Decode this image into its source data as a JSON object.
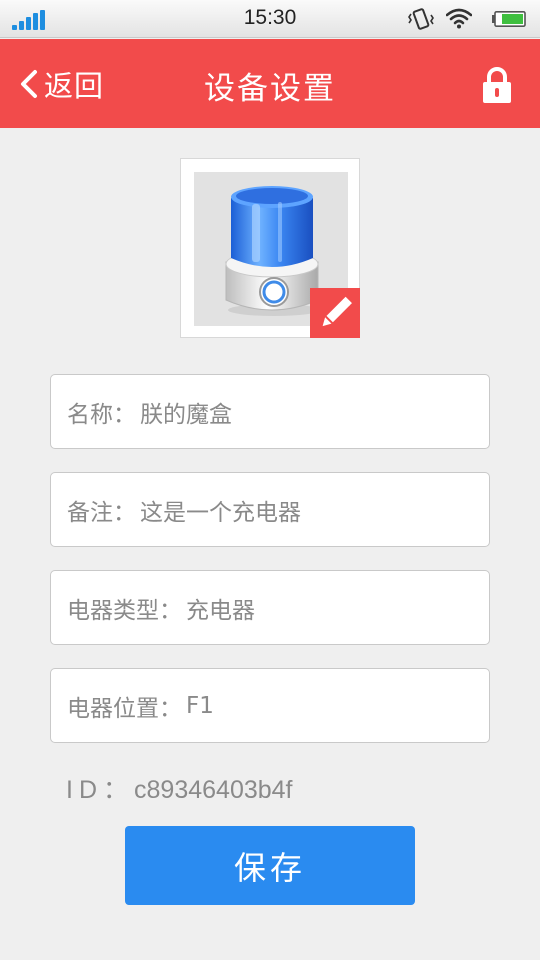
{
  "status_bar": {
    "time": "15:30"
  },
  "header": {
    "back_label": "返回",
    "title": "设备设置",
    "lock_icon": "lock-icon"
  },
  "device": {
    "image_icon": "humidifier-icon",
    "edit_icon": "pencil-icon"
  },
  "fields": [
    {
      "label": "名称：",
      "value": "朕的魔盒"
    },
    {
      "label": "备注：",
      "value": "这是一个充电器"
    },
    {
      "label": "电器类型：",
      "value": "充电器"
    },
    {
      "label": "电器位置：",
      "value": "F1"
    }
  ],
  "device_id": {
    "label": "ID：",
    "value": "c89346403b4f"
  },
  "save_label": "保存",
  "colors": {
    "header": "#f24b4b",
    "save": "#2a8bf0",
    "background": "#efefef",
    "field_text": "#8a8a8a"
  }
}
